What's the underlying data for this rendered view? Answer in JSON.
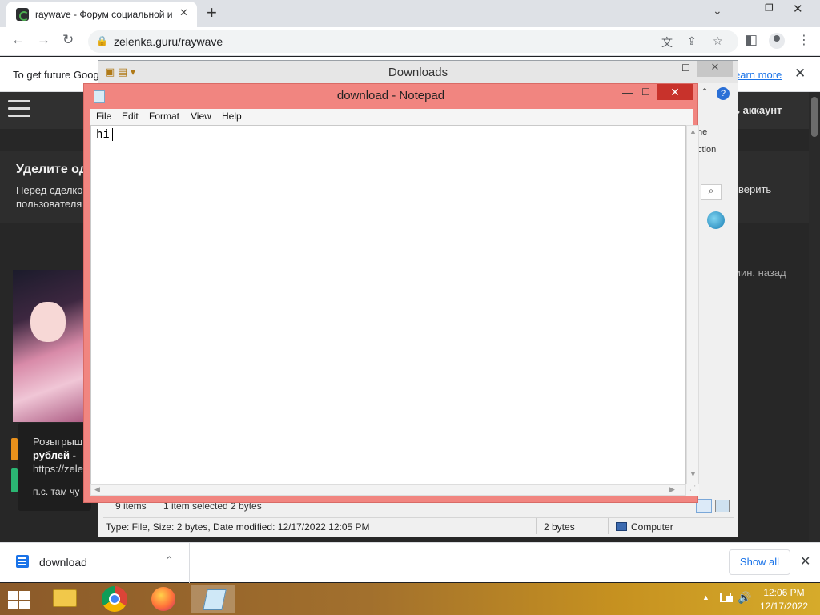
{
  "browser": {
    "tab_title": "raywave - Форум социальной и",
    "url": "zelenka.guru/raywave",
    "infobar_text": "To get future Goog",
    "infobar_link": "earn more",
    "icons": {
      "back": "←",
      "forward": "→",
      "reload": "↻",
      "lock": "🔒",
      "translate": "文",
      "share": "⇪",
      "bookmark": "☆",
      "side_panel": "◧",
      "menu": "⋮",
      "close": "✕",
      "new_tab": "+",
      "tab_search": "⌄",
      "minimize": "—",
      "maximize": "❐"
    }
  },
  "site": {
    "login": "ь аккаунт",
    "notice_title": "Уделите од",
    "notice_body_1": "Перед сделко",
    "notice_body_2": "пользователя",
    "notice_right": "верить",
    "post_time": "мин. назад",
    "popup_title": "Розыгрыш",
    "popup_bold": "рублей -",
    "popup_link": "https://zele",
    "popup_note": "п.с. там чу"
  },
  "explorer": {
    "title": "Downloads",
    "items_count": "9 items",
    "selected_text": "1 item selected  2 bytes",
    "ribbon_text_1": "ne",
    "ribbon_text_2": "ction",
    "search_icon": "⌕",
    "info_text": "Type: File, Size: 2 bytes, Date modified: 12/17/2022 12:05 PM",
    "info_size": "2 bytes",
    "info_location": "Computer",
    "list_fragments": [
      "e",
      "e",
      "e",
      "e",
      "e",
      "e",
      "e",
      "e"
    ],
    "icons": {
      "minimize": "—",
      "maximize": "☐",
      "close": "✕",
      "help": "?",
      "up": "⌃"
    }
  },
  "notepad": {
    "title": "download - Notepad",
    "menu": [
      "File",
      "Edit",
      "Format",
      "View",
      "Help"
    ],
    "content": "hi",
    "icons": {
      "minimize": "—",
      "maximize": "☐",
      "close": "✕",
      "scroll_up": "▲",
      "scroll_down": "▼",
      "scroll_left": "◀",
      "scroll_right": "▶",
      "grip": "⋰"
    }
  },
  "downloads_shelf": {
    "filename": "download",
    "show_all": "Show all",
    "chevron": "⌃",
    "close": "✕"
  },
  "taskbar": {
    "apps": [
      "File Explorer",
      "Google Chrome",
      "Firefox",
      "Notepad"
    ],
    "active_app": "Notepad",
    "time": "12:06 PM",
    "date": "12/17/2022",
    "tray_up": "▲",
    "volume": "🔊"
  },
  "colors": {
    "notepad_frame": "#f18580",
    "notepad_close": "#c8322b",
    "link_blue": "#1a73e8",
    "site_bg": "#272727"
  }
}
